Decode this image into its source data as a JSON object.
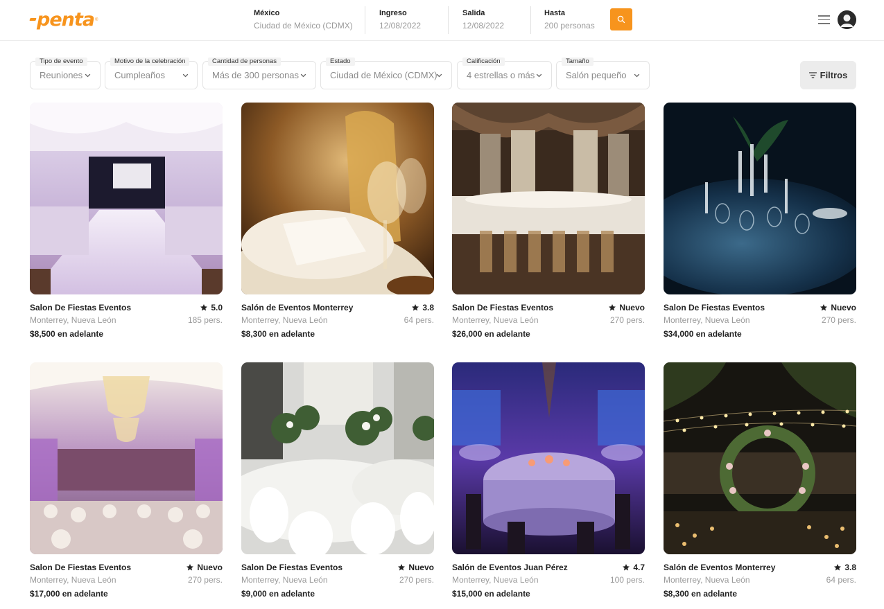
{
  "brand": {
    "name": "penta",
    "accent": "#f7941d"
  },
  "search": {
    "location": {
      "label": "México",
      "value": "Ciudad de México (CDMX)"
    },
    "checkin": {
      "label": "Ingreso",
      "value": "12/08/2022"
    },
    "checkout": {
      "label": "Salida",
      "value": "12/08/2022"
    },
    "guests": {
      "label": "Hasta",
      "value": "200 personas"
    },
    "button_icon": "search-icon"
  },
  "header_icons": {
    "menu": "hamburger-menu-icon",
    "profile": "user-avatar-icon"
  },
  "filters": [
    {
      "label": "Tipo de evento",
      "value": "Reuniones"
    },
    {
      "label": "Motivo de la celebración",
      "value": "Cumpleaños"
    },
    {
      "label": "Cantidad de personas",
      "value": "Más de 300 personas"
    },
    {
      "label": "Estado",
      "value": "Ciudad de México (CDMX)"
    },
    {
      "label": "Calificación",
      "value": "4 estrellas o más"
    },
    {
      "label": "Tamaño",
      "value": "Salón pequeño"
    }
  ],
  "filters_button": {
    "label": "Filtros",
    "icon": "filter-lines-icon"
  },
  "listings": [
    {
      "title": "Salon De Fiestas Eventos",
      "rating": "5.0",
      "location": "Monterrey, Nueva León",
      "capacity": "185 pers.",
      "price": "$8,500 en adelante",
      "photo": "white-draped-banquet-hall"
    },
    {
      "title": "Salón de Eventos Monterrey",
      "rating": "3.8",
      "location": "Monterrey, Nueva León",
      "capacity": "64 pers.",
      "price": "$8,300 en adelante",
      "photo": "gold-chair-wine-glasses"
    },
    {
      "title": "Salon De Fiestas Eventos",
      "rating": "Nuevo",
      "location": "Monterrey, Nueva León",
      "capacity": "270 pers.",
      "price": "$26,000 en adelante",
      "photo": "classic-dark-dining-hall"
    },
    {
      "title": "Salon De Fiestas Eventos",
      "rating": "Nuevo",
      "location": "Monterrey, Nueva León",
      "capacity": "270 pers.",
      "price": "$34,000 en adelante",
      "photo": "night-table-candles-blue"
    },
    {
      "title": "Salon De Fiestas Eventos",
      "rating": "Nuevo",
      "location": "Monterrey, Nueva León",
      "capacity": "270 pers.",
      "price": "$17,000 en adelante",
      "photo": "chandelier-ballroom-purple"
    },
    {
      "title": "Salon De Fiestas Eventos",
      "rating": "Nuevo",
      "location": "Monterrey, Nueva León",
      "capacity": "270 pers.",
      "price": "$9,000 en adelante",
      "photo": "white-tables-floral-centerpieces"
    },
    {
      "title": "Salón de Eventos Juan Pérez",
      "rating": "4.7",
      "location": "Monterrey, Nueva León",
      "capacity": "100 pers.",
      "price": "$15,000 en adelante",
      "photo": "purple-uplit-round-tables"
    },
    {
      "title": "Salón de Eventos Monterrey",
      "rating": "3.8",
      "location": "Monterrey, Nueva León",
      "capacity": "64 pers.",
      "price": "$8,300 en adelante",
      "photo": "garden-floral-arch-string-lights"
    }
  ]
}
